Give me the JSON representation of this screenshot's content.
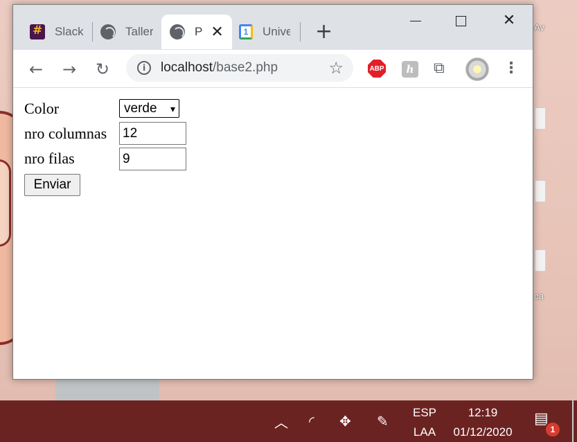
{
  "desktop": {
    "labels": [
      "Av",
      "ca"
    ]
  },
  "browser": {
    "tabs": [
      {
        "label": "Slack",
        "icon": "slack-icon"
      },
      {
        "label": "Taller",
        "icon": "globe-icon"
      },
      {
        "label": "P",
        "icon": "globe-icon",
        "active": true
      },
      {
        "label": "Unive",
        "icon": "calendar-icon"
      }
    ],
    "new_tab": "+",
    "address": {
      "host": "localhost",
      "path": "/base2.php"
    },
    "extensions": {
      "abp": "ABP",
      "h": "h"
    }
  },
  "form": {
    "color_label": "Color",
    "color_value": "verde",
    "columns_label": "nro columnas",
    "columns_value": "12",
    "rows_label": "nro filas",
    "rows_value": "9",
    "submit_label": "Enviar"
  },
  "taskbar": {
    "lang_top": "ESP",
    "lang_bottom": "LAA",
    "time": "12:19",
    "date": "01/12/2020",
    "notification_count": "1"
  }
}
